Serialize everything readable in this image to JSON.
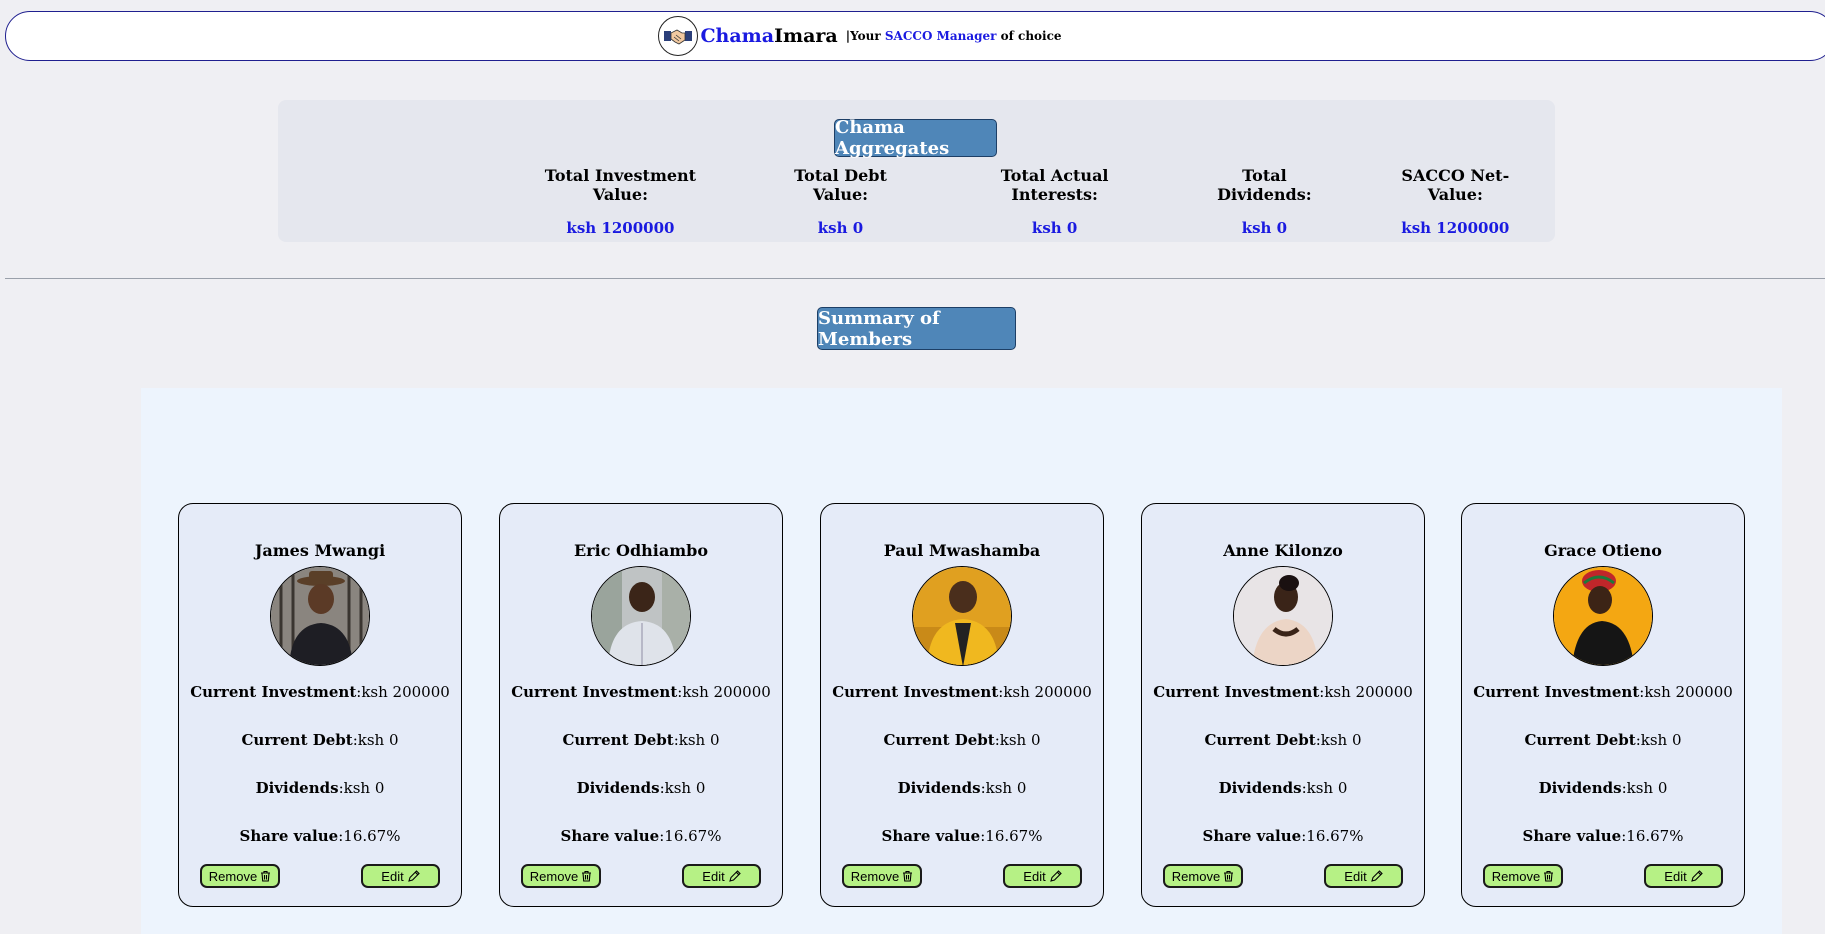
{
  "header": {
    "brand_part1": "Chama",
    "brand_part2": "Imara",
    "tagline_pre": "|Your ",
    "tagline_highlight": "SACCO Manager",
    "tagline_post": " of choice",
    "logo_icon": "handshake-icon"
  },
  "aggregates": {
    "title": "Chama Aggregates",
    "stats": [
      {
        "label": "Total Investment Value:",
        "value": "ksh 1200000"
      },
      {
        "label": "Total Debt Value:",
        "value": "ksh 0"
      },
      {
        "label": "Total Actual Interests:",
        "value": "ksh 0"
      },
      {
        "label": "Total Dividends:",
        "value": "ksh 0"
      },
      {
        "label": "SACCO Net-Value:",
        "value": "ksh 1200000"
      }
    ]
  },
  "members": {
    "title": "Summary of Members",
    "field_labels": {
      "investment": "Current Investment",
      "debt": "Current Debt",
      "dividends": "Dividends",
      "share": "Share value"
    },
    "buttons": {
      "remove": "Remove",
      "edit": "Edit"
    },
    "list": [
      {
        "name": "James Mwangi",
        "investment": "ksh 200000",
        "debt": "ksh 0",
        "dividends": "ksh 0",
        "share": "16.67%"
      },
      {
        "name": "Eric Odhiambo",
        "investment": "ksh 200000",
        "debt": "ksh 0",
        "dividends": "ksh 0",
        "share": "16.67%"
      },
      {
        "name": "Paul Mwashamba",
        "investment": "ksh 200000",
        "debt": "ksh 0",
        "dividends": "ksh 0",
        "share": "16.67%"
      },
      {
        "name": "Anne Kilonzo",
        "investment": "ksh 200000",
        "debt": "ksh 0",
        "dividends": "ksh 0",
        "share": "16.67%"
      },
      {
        "name": "Grace Otieno",
        "investment": "ksh 200000",
        "debt": "ksh 0",
        "dividends": "ksh 0",
        "share": "16.67%"
      }
    ]
  },
  "colors": {
    "brand_blue": "#1a1ae0",
    "section_button": "#4f86b8",
    "action_button": "#b6f185"
  }
}
